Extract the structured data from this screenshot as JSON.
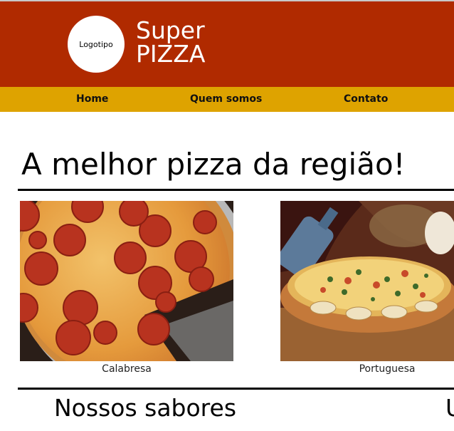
{
  "header": {
    "logo_text": "Logotipo",
    "brand_line1": "Super",
    "brand_line2": "PIZZA",
    "background": "#b02a00"
  },
  "nav": {
    "background": "#dea300",
    "items": [
      {
        "label": "Home"
      },
      {
        "label": "Quem somos"
      },
      {
        "label": "Contato"
      }
    ]
  },
  "hero": {
    "title": "A melhor pizza da região!"
  },
  "gallery": [
    {
      "caption": "Calabresa",
      "image": "pepperoni-pizza-photo"
    },
    {
      "caption": "Portuguesa",
      "image": "portuguesa-pizza-photo"
    }
  ],
  "flavors": {
    "title": "Nossos sabores",
    "next_title_fragment": "U"
  }
}
